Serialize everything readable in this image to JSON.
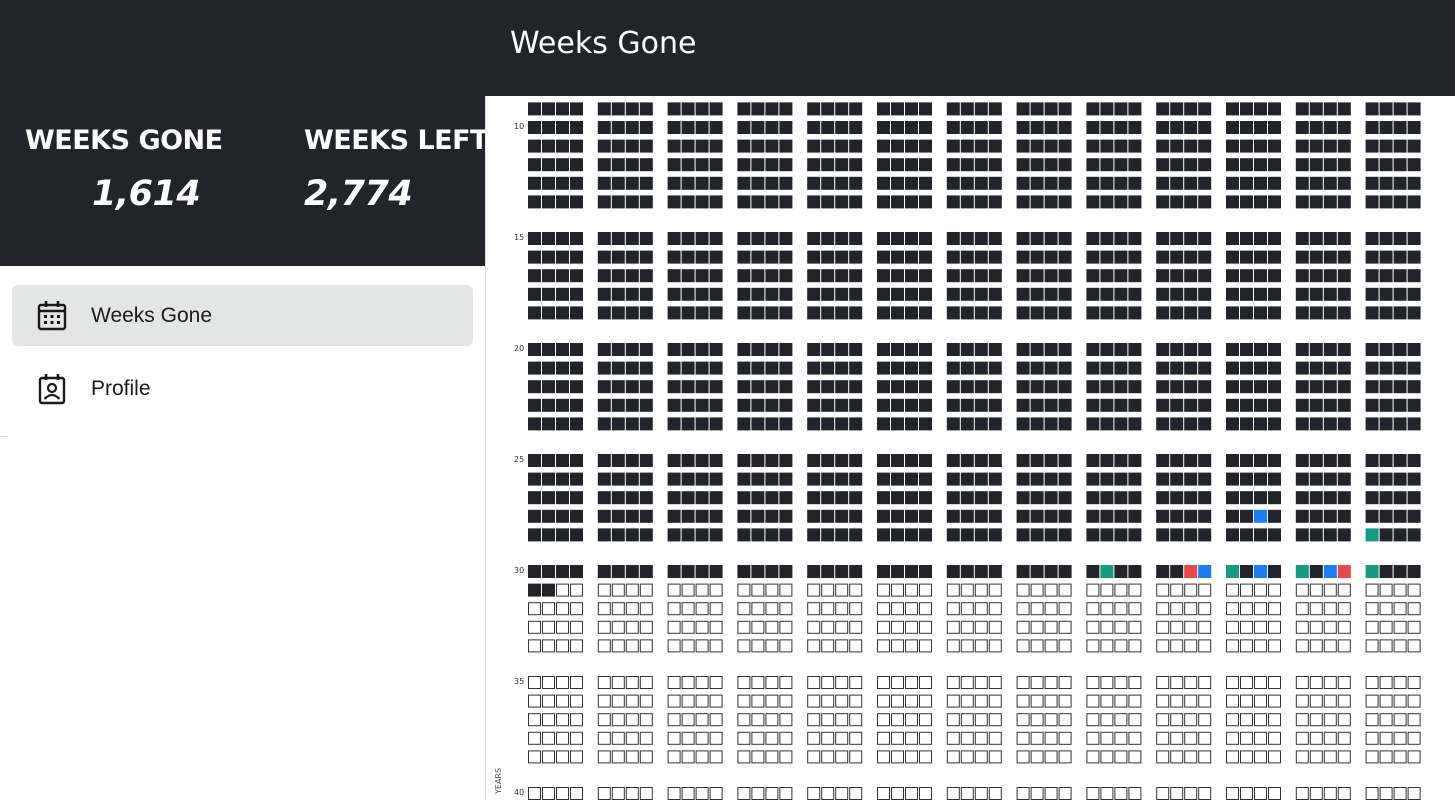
{
  "stats": {
    "weeks_gone_label": "WEEKS GONE",
    "weeks_gone_value": "1,614",
    "weeks_left_label": "WEEKS LEFT",
    "weeks_left_value": "2,774"
  },
  "nav": {
    "items": [
      {
        "label": "Weeks Gone",
        "icon": "calendar-icon",
        "active": true
      },
      {
        "label": "Profile",
        "icon": "profile-badge-icon",
        "active": false
      }
    ]
  },
  "header": {
    "title": "Weeks Gone"
  },
  "grid": {
    "axis_label": "YEARS",
    "start_year": 10,
    "years_per_block": 5,
    "year_labels": [
      "10",
      "15",
      "20",
      "25",
      "30",
      "35",
      "40"
    ],
    "weeks_per_year_columns": 13,
    "weeks_per_column_row": 4,
    "weeks_gone": 1614,
    "colors": {
      "filled": "#21252b",
      "empty_border": "#333333",
      "teal": "#159a84",
      "blue": "#1a7ff5",
      "red": "#e5484d"
    },
    "highlights": [
      {
        "year": 28,
        "column": 11,
        "week": 2,
        "color": "blue"
      },
      {
        "year": 29,
        "column": 13,
        "week": 0,
        "color": "teal"
      },
      {
        "year": 30,
        "column": 9,
        "week": 1,
        "color": "teal"
      },
      {
        "year": 30,
        "column": 10,
        "week": 2,
        "color": "red"
      },
      {
        "year": 30,
        "column": 10,
        "week": 3,
        "color": "blue"
      },
      {
        "year": 30,
        "column": 11,
        "week": 0,
        "color": "teal"
      },
      {
        "year": 30,
        "column": 11,
        "week": 2,
        "color": "blue"
      },
      {
        "year": 30,
        "column": 12,
        "week": 0,
        "color": "teal"
      },
      {
        "year": 30,
        "column": 12,
        "week": 2,
        "color": "blue"
      },
      {
        "year": 30,
        "column": 12,
        "week": 3,
        "color": "red"
      },
      {
        "year": 30,
        "column": 13,
        "week": 0,
        "color": "teal"
      }
    ]
  }
}
